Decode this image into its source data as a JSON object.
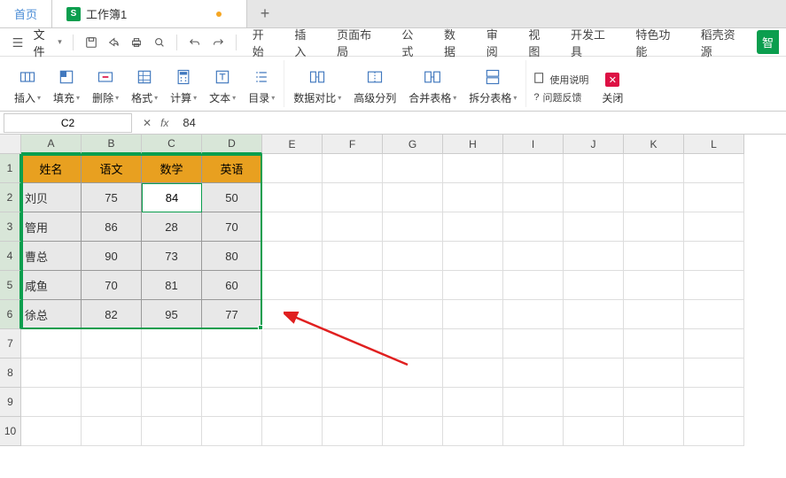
{
  "tabs": {
    "home": "首页",
    "workbook": "工作簿1"
  },
  "menubar": {
    "file": "文件",
    "items": [
      "开始",
      "插入",
      "页面布局",
      "公式",
      "数据",
      "审阅",
      "视图",
      "开发工具",
      "特色功能",
      "稻壳资源"
    ],
    "badge": "智"
  },
  "ribbon": {
    "insert": "插入",
    "fill": "填充",
    "delete": "删除",
    "format": "格式",
    "calc": "计算",
    "text": "文本",
    "toc": "目录",
    "datacompare": "数据对比",
    "advsplit": "高级分列",
    "merge": "合并表格",
    "split": "拆分表格",
    "help": "使用说明",
    "feedback": "问题反馈",
    "close": "关闭"
  },
  "formula": {
    "namebox": "C2",
    "value": "84"
  },
  "columns": [
    "A",
    "B",
    "C",
    "D",
    "E",
    "F",
    "G",
    "H",
    "I",
    "J",
    "K",
    "L"
  ],
  "rows": [
    "1",
    "2",
    "3",
    "4",
    "5",
    "6",
    "7",
    "8",
    "9",
    "10"
  ],
  "chart_data": {
    "type": "table",
    "headers": [
      "姓名",
      "语文",
      "数学",
      "英语"
    ],
    "data": [
      {
        "name": "刘贝",
        "chinese": 75,
        "math": 84,
        "english": 50
      },
      {
        "name": "管用",
        "chinese": 86,
        "math": 28,
        "english": 70
      },
      {
        "name": "曹总",
        "chinese": 90,
        "math": 73,
        "english": 80
      },
      {
        "name": "咸鱼",
        "chinese": 70,
        "math": 81,
        "english": 60
      },
      {
        "name": "徐总",
        "chinese": 82,
        "math": 95,
        "english": 77
      }
    ]
  },
  "selection": {
    "active_cell": "C2",
    "active_value": "84",
    "range": "A1:D6"
  }
}
